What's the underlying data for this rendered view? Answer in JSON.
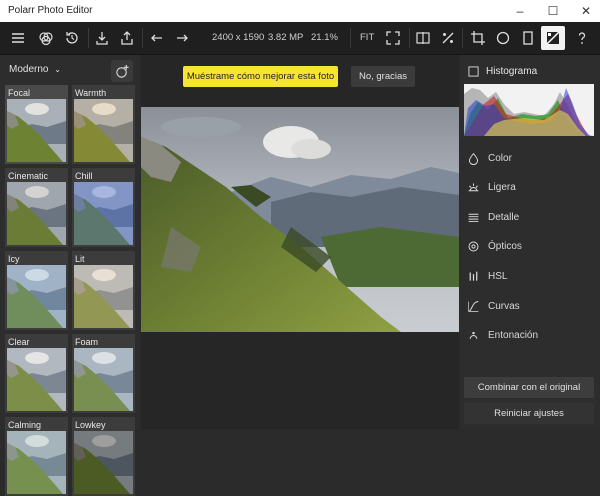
{
  "window": {
    "title": "Polarr Photo Editor",
    "controls": [
      "–",
      "☐",
      "✕"
    ]
  },
  "toolbar": {
    "image_size": "2400 x 1590",
    "megapixels": "3.82 MP",
    "zoom": "21.1%",
    "fit_label": "FIT",
    "icons": [
      "menu-icon",
      "layers-icon",
      "history-icon",
      "download-icon",
      "share-icon",
      "undo-icon",
      "redo-icon",
      "fullscreen-icon",
      "compare-icon",
      "percent-icon",
      "crop-icon",
      "circle-mask-icon",
      "square-mask-icon",
      "filters-icon",
      "help-icon"
    ]
  },
  "left_panel": {
    "preset_group": "Moderno",
    "presets": [
      {
        "name": "Focal"
      },
      {
        "name": "Warmth"
      },
      {
        "name": "Cinematic"
      },
      {
        "name": "Chill"
      },
      {
        "name": "Icy"
      },
      {
        "name": "Lit"
      },
      {
        "name": "Clear"
      },
      {
        "name": "Foam"
      },
      {
        "name": "Calming"
      },
      {
        "name": "Lowkey"
      }
    ]
  },
  "center": {
    "hint_button": "Muéstrame cómo mejorar esta foto",
    "dismiss_button": "No, gracias"
  },
  "right_panel": {
    "histogram_title": "Histograma",
    "items": [
      {
        "label": "Color",
        "icon": "droplet-icon"
      },
      {
        "label": "Ligera",
        "icon": "sunrise-icon"
      },
      {
        "label": "Detalle",
        "icon": "lines-icon"
      },
      {
        "label": "Ópticos",
        "icon": "lens-icon"
      },
      {
        "label": "HSL",
        "icon": "bars-icon"
      },
      {
        "label": "Curvas",
        "icon": "curve-icon"
      },
      {
        "label": "Entonación",
        "icon": "toning-icon"
      }
    ],
    "combine_button": "Combinar con el original",
    "reset_button": "Reiniciar ajustes"
  }
}
